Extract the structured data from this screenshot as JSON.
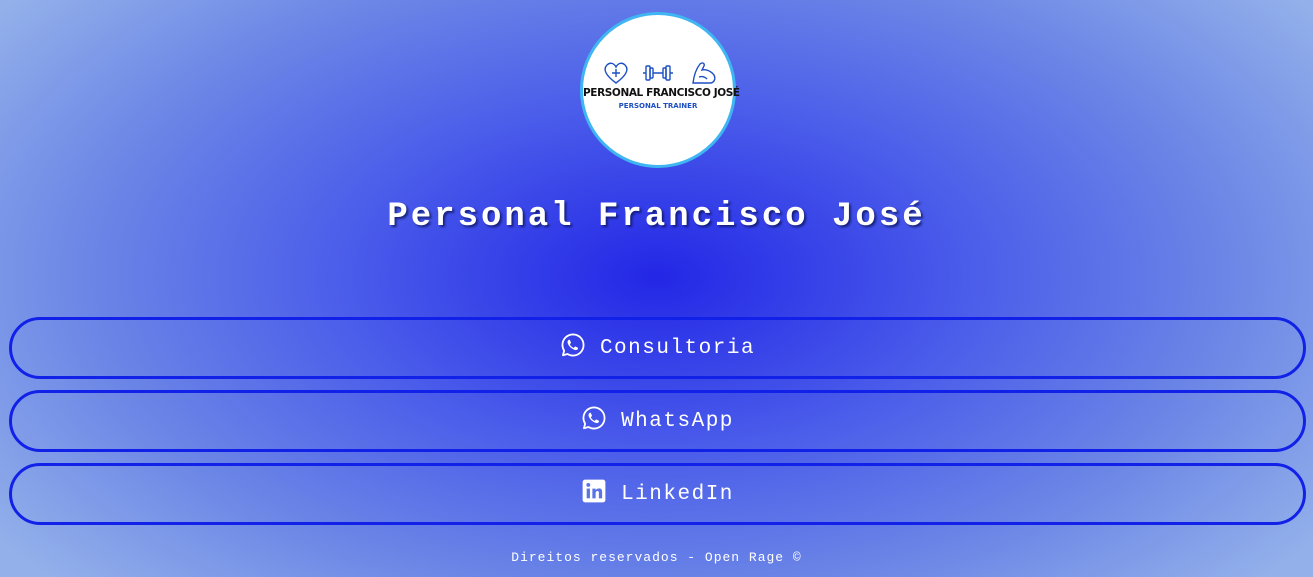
{
  "profile": {
    "logo": {
      "title": "PERSONAL FRANCISCO JOSÉ",
      "subtitle": "PERSONAL TRAINER",
      "icons": [
        "heart-plus-icon",
        "dumbbell-icon",
        "flexed-arm-icon"
      ]
    },
    "name": "Personal Francisco José"
  },
  "links": [
    {
      "label": "Consultoria",
      "icon": "whatsapp-icon"
    },
    {
      "label": "WhatsApp",
      "icon": "whatsapp-icon"
    },
    {
      "label": "LinkedIn",
      "icon": "linkedin-icon"
    }
  ],
  "footer": {
    "text": "Direitos reservados - Open Rage ©"
  },
  "colors": {
    "background_center": "#2327e6",
    "background_edge": "#93b0ea",
    "button_border": "#1221e8",
    "logo_border": "#3fb6f2",
    "text": "#ffffff"
  }
}
